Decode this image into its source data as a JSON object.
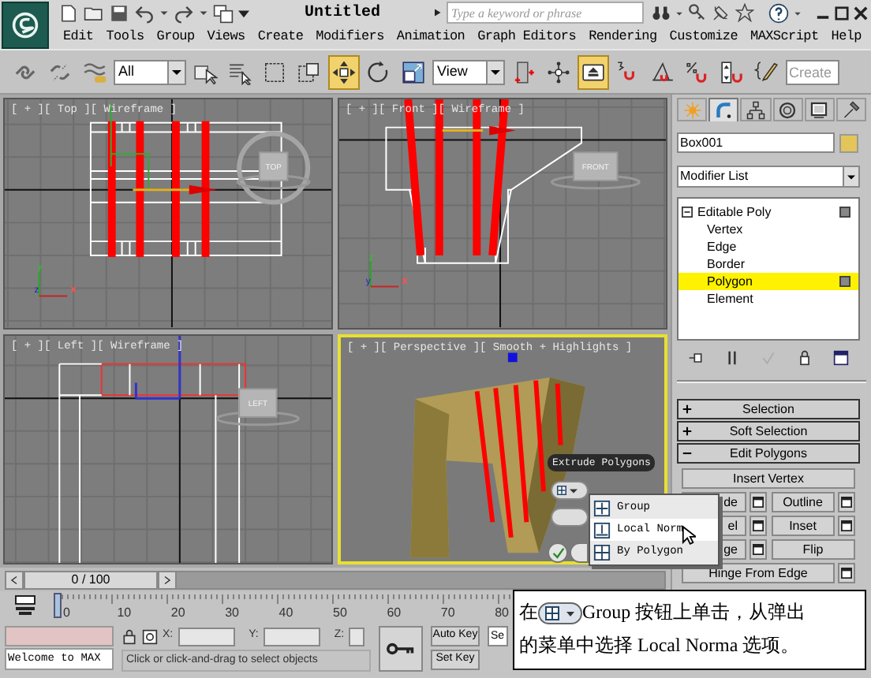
{
  "title_bar": {
    "title": "Untitled",
    "search_placeholder": "Type a keyword or phrase"
  },
  "menu": [
    "Edit",
    "Tools",
    "Group",
    "Views",
    "Create",
    "Modifiers",
    "Animation",
    "Graph Editors",
    "Rendering",
    "Customize",
    "MAXScript",
    "Help"
  ],
  "toolbar": [
    {
      "kind": "link",
      "active": false
    },
    {
      "kind": "unlink",
      "active": false
    },
    {
      "kind": "bind",
      "active": false
    },
    {
      "kind": "dropdown",
      "value": "All"
    },
    {
      "kind": "select",
      "active": false
    },
    {
      "kind": "select-by-name",
      "active": false
    },
    {
      "kind": "region",
      "active": false
    },
    {
      "kind": "crossing",
      "active": false
    },
    {
      "kind": "move",
      "active": true
    },
    {
      "kind": "rotate",
      "active": false
    },
    {
      "kind": "scale",
      "active": false
    },
    {
      "kind": "dropdown",
      "value": "View"
    },
    {
      "kind": "pivot",
      "active": false
    },
    {
      "kind": "manipulate",
      "active": false
    },
    {
      "kind": "shortcut",
      "active": true
    },
    {
      "kind": "snap",
      "active": false
    },
    {
      "kind": "angle-snap",
      "active": false
    },
    {
      "kind": "percent-snap",
      "active": false
    },
    {
      "kind": "spinner-snap",
      "active": false
    },
    {
      "kind": "named-edit",
      "active": false
    },
    {
      "kind": "input",
      "placeholder": "Create"
    }
  ],
  "viewports": [
    {
      "label": "[ + ][ Top ][ Wireframe ]",
      "kind": "top",
      "active": false,
      "cube_label": "TOP",
      "axes": [
        "y",
        "z",
        "x"
      ]
    },
    {
      "label": "[ + ][ Front ][ Wireframe ]",
      "kind": "front",
      "active": false,
      "cube_label": "FRONT",
      "axes": [
        "z",
        "y",
        "x"
      ]
    },
    {
      "label": "[ + ][ Left ][ Wireframe ]",
      "kind": "left",
      "active": false,
      "cube_label": "LEFT"
    },
    {
      "label": "[ + ][ Perspective ][ Smooth + Highlights ]",
      "kind": "perspective",
      "active": true
    }
  ],
  "command_panel": {
    "tabs": [
      {
        "kind": "create",
        "selected": false
      },
      {
        "kind": "modify",
        "selected": true
      },
      {
        "kind": "hierarchy",
        "selected": false
      },
      {
        "kind": "motion",
        "selected": false
      },
      {
        "kind": "display",
        "selected": false
      },
      {
        "kind": "utilities",
        "selected": false
      }
    ],
    "object_name": "Box001",
    "modifier_list": "Modifier List",
    "stack": [
      {
        "label": "Editable Poly",
        "expanded": true,
        "children": [
          {
            "label": "Vertex",
            "selected": false
          },
          {
            "label": "Edge",
            "selected": false
          },
          {
            "label": "Border",
            "selected": false
          },
          {
            "label": "Polygon",
            "selected": true
          },
          {
            "label": "Element",
            "selected": false
          }
        ]
      }
    ],
    "rollouts": [
      {
        "label": "Selection",
        "expanded": false
      },
      {
        "label": "Soft Selection",
        "expanded": false
      },
      {
        "label": "Edit Polygons",
        "expanded": true
      }
    ],
    "button_rows": [
      [
        {
          "label": "Insert Vertex",
          "settings": false
        }
      ],
      [
        {
          "label": "de",
          "settings": true
        },
        {
          "label": "Outline",
          "settings": true
        }
      ],
      [
        {
          "label": "el",
          "settings": true
        },
        {
          "label": "Inset",
          "settings": true
        }
      ],
      [
        {
          "label": "ge",
          "settings": true
        },
        {
          "label": "Flip",
          "settings": false
        }
      ],
      [
        {
          "label": "Hinge From Edge",
          "settings": true
        }
      ]
    ]
  },
  "caddy": {
    "caption": "Extrude Polygons",
    "menu": [
      {
        "label": "Group",
        "kind": "group",
        "selected": false
      },
      {
        "label": "Local Norm",
        "kind": "local",
        "selected": true
      },
      {
        "label": "By Polygon",
        "kind": "polygon",
        "selected": false
      }
    ]
  },
  "time_slider": {
    "readout": "0 / 100",
    "level": 0,
    "ticks": [
      "0",
      "10",
      "20",
      "30",
      "40",
      "50",
      "60",
      "70",
      "80"
    ]
  },
  "status": {
    "welcome": "Welcome to MAX",
    "prompt": "Click or click-and-drag to select objects",
    "coords": [
      "X:",
      "Y:",
      "Z:"
    ],
    "auto_key": "Auto Key",
    "set_key": "Set Key",
    "key_filter": "Se"
  },
  "callout": {
    "before_icon": "在",
    "after_icon": "Group 按钮上单击，从弹出",
    "second_line": "的菜单中选择 Local Norma 选项。"
  }
}
